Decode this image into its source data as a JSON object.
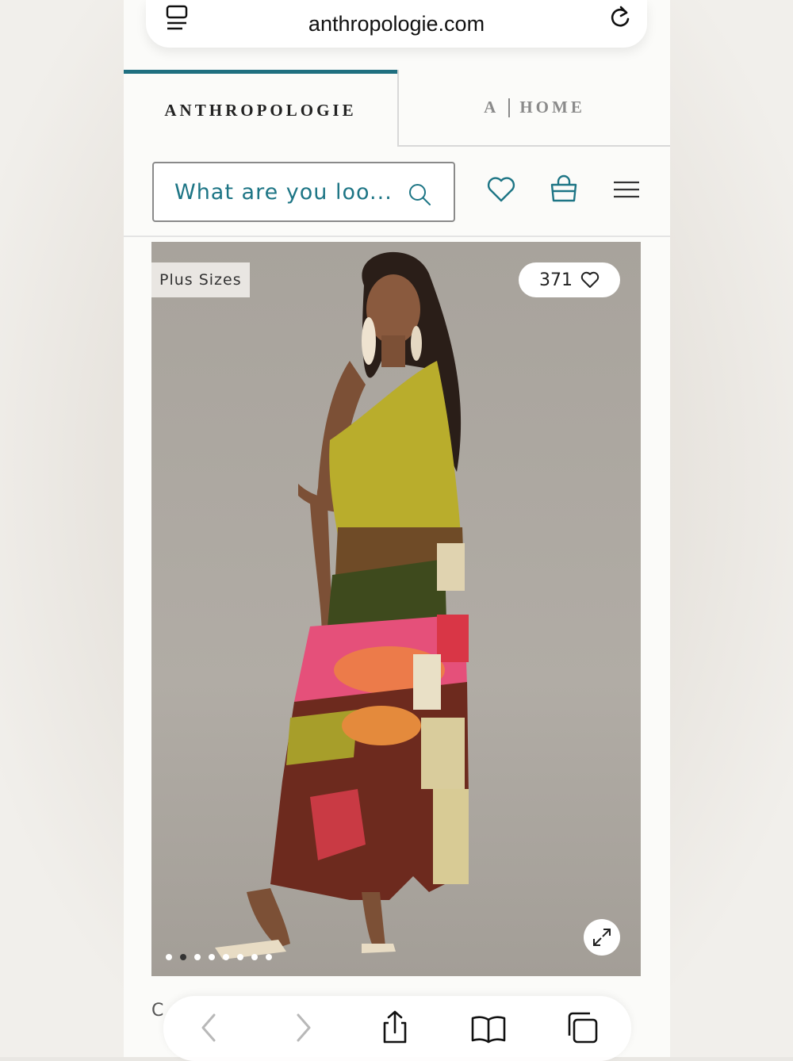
{
  "browser": {
    "url": "anthropologie.com"
  },
  "tabs": [
    {
      "label": "ANTHROPOLOGIE"
    },
    {
      "label_a": "A",
      "label_home": "HOME"
    }
  ],
  "search": {
    "placeholder": "What are you loo..."
  },
  "product": {
    "badge": "Plus Sizes",
    "favorites_count": "371",
    "image_count": 8,
    "active_image_index": 1
  },
  "below_text": "C",
  "colors": {
    "accent": "#1f6f80",
    "link": "#1d7585"
  }
}
